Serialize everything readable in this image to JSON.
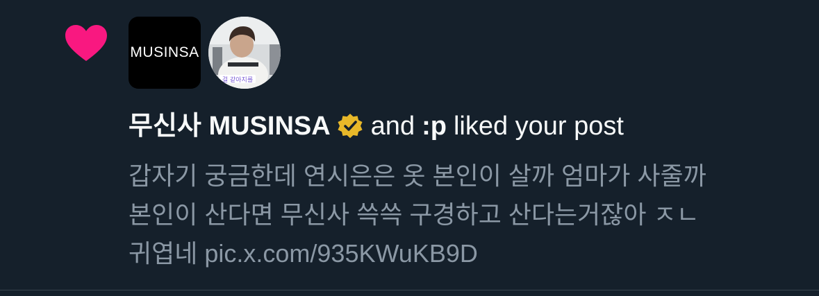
{
  "notification": {
    "brand_avatar_text": "MUSINSA",
    "actor_name": "무신사 MUSINSA",
    "connector": "and",
    "second_actor": ":p",
    "action_text": "liked your post",
    "post_lines": [
      "갑자기 궁금한데 연시은은 옷 본인이 살까 엄마가 사줄까",
      "본인이 산다면 무신사 쓱쓱 구경하고 산다는거잖아 ㅈㄴ",
      "귀엽네 pic.x.com/935KWuKB9D"
    ],
    "avatar_caption": "걸 같아지를"
  },
  "colors": {
    "background": "#15202b",
    "heart": "#f91880",
    "verified_gold": "#e8b829",
    "text_primary": "#f7f9f9",
    "text_secondary": "#8b98a5"
  },
  "icons": {
    "like": "heart-icon",
    "verified": "verified-badge-icon"
  }
}
